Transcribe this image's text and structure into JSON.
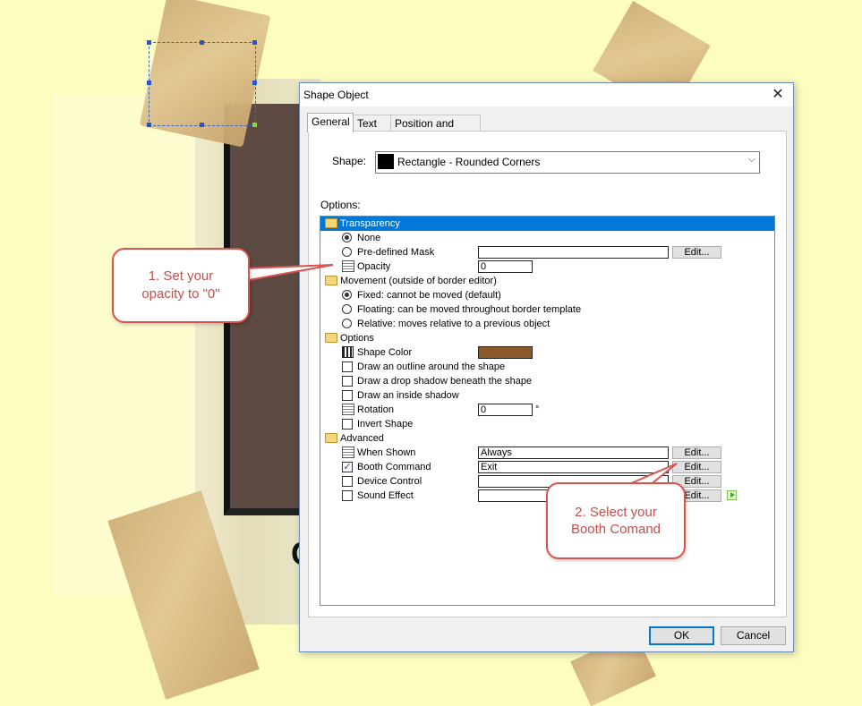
{
  "dialog": {
    "title": "Shape Object",
    "tabs": [
      "General",
      "Text",
      "Position and Size"
    ],
    "shape_label": "Shape:",
    "shape_value": "Rectangle - Rounded Corners",
    "options_label": "Options:",
    "tree": {
      "transparency": "Transparency",
      "none": "None",
      "predefined_mask": "Pre-defined Mask",
      "opacity": "Opacity",
      "opacity_value": "0",
      "movement": "Movement  (outside of border editor)",
      "fixed": "Fixed:  cannot be moved (default)",
      "floating": "Floating:  can be moved throughout border template",
      "relative": "Relative:  moves relative to a previous object",
      "options": "Options",
      "shape_color": "Shape Color",
      "shape_color_hex": "#8a5a2b",
      "outline": "Draw an outline around the shape",
      "drop_shadow": "Draw a drop shadow beneath the shape",
      "inside_shadow": "Draw an inside shadow",
      "rotation": "Rotation",
      "rotation_value": "0",
      "rotation_unit": "°",
      "invert": "Invert Shape",
      "advanced": "Advanced",
      "when_shown": "When Shown",
      "when_shown_value": "Always",
      "booth_command": "Booth Command",
      "booth_command_value": "Exit",
      "device_control": "Device Control",
      "sound_effect": "Sound Effect",
      "edit": "Edit..."
    },
    "ok": "OK",
    "cancel": "Cancel"
  },
  "callouts": {
    "one": "1. Set your opacity to \"0\"",
    "two": "2. Select your Booth Comand"
  },
  "background": {
    "letter": "C"
  }
}
